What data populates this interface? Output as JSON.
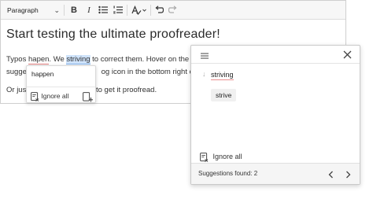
{
  "toolbar": {
    "paragraph_select": "Paragraph",
    "bold_label": "B",
    "italic_label": "I"
  },
  "content": {
    "heading": "Start testing the ultimate proofreader!",
    "line1": {
      "before": "Typos ",
      "err1": "hapen",
      "mid": ". We ",
      "err2": "striving",
      "after": " to correct them. Hover on the m"
    },
    "line2": {
      "start": "sugges",
      "end": "og icon in the bottom right co"
    },
    "line3": {
      "start": "Or just",
      "end": "to get it proofread."
    }
  },
  "popup": {
    "suggestion": "happen",
    "ignore_all": "Ignore all"
  },
  "panel": {
    "error_word": "striving",
    "suggestion": "strive",
    "ignore_all": "Ignore all",
    "suggestions_found": "Suggestions found: 2"
  },
  "colors": {
    "spelling_underline": "#e07a7a",
    "grammar_highlight": "#cfe3fb",
    "toolbar_bg": "#f7f7f7",
    "footer_bg": "#f5f5f5"
  },
  "icons": [
    "chevron-down-icon",
    "bold-icon",
    "italic-icon",
    "bulleted-list-icon",
    "numbered-list-icon",
    "spellcheck-icon",
    "undo-icon",
    "redo-icon",
    "menu-icon",
    "close-icon",
    "ignore-all-icon",
    "add-to-dictionary-icon",
    "chevron-left-icon",
    "chevron-right-icon"
  ]
}
